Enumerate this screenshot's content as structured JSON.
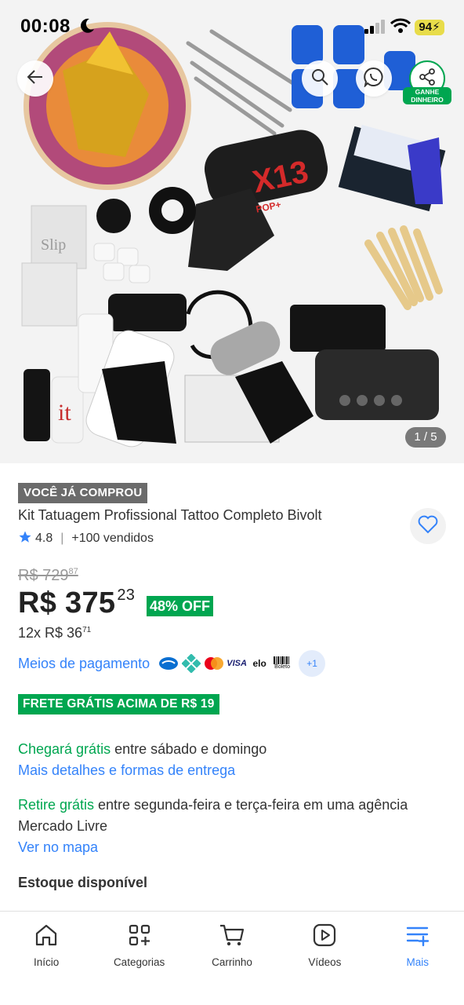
{
  "status_bar": {
    "time": "00:08",
    "battery": "94"
  },
  "gallery": {
    "page_counter": "1 / 5"
  },
  "header_actions": {
    "share_badge": "GANHE DINHEIRO"
  },
  "product": {
    "bought_badge": "VOCÊ JÁ COMPROU",
    "title": "Kit Tatuagem Profissional Tattoo Completo Bivolt",
    "rating": "4.8",
    "sold": "+100 vendidos",
    "old_price_main": "R$ 729",
    "old_price_cents": "87",
    "price_main": "R$ 375",
    "price_cents": "23",
    "discount": "48% OFF",
    "installments_main": "12x R$ 36",
    "installments_cents": "71"
  },
  "payment": {
    "link": "Meios de pagamento",
    "methods": [
      "mercado-pago-icon",
      "pix-icon",
      "mastercard-icon",
      "visa-icon",
      "elo-icon",
      "boleto-icon"
    ],
    "visa": "VISA",
    "elo": "elo",
    "boleto": "Boleto",
    "more": "+1"
  },
  "shipping": {
    "frete_badge": "FRETE GRÁTIS ACIMA DE R$ 19",
    "arrive_label": "Chegará grátis",
    "arrive_text": " entre sábado e domingo",
    "delivery_link": "Mais detalhes e formas de entrega",
    "pickup_label": "Retire grátis",
    "pickup_text": " entre segunda-feira e terça-feira em uma agência Mercado Livre",
    "map_link": "Ver no mapa"
  },
  "stock": {
    "label": "Estoque disponível"
  },
  "nav": {
    "items": [
      {
        "label": "Início",
        "icon": "home-icon"
      },
      {
        "label": "Categorias",
        "icon": "categories-icon"
      },
      {
        "label": "Carrinho",
        "icon": "cart-icon"
      },
      {
        "label": "Vídeos",
        "icon": "videos-icon"
      },
      {
        "label": "Mais",
        "icon": "more-icon"
      }
    ]
  },
  "colors": {
    "accent_blue": "#3483fa",
    "green": "#00a650",
    "grey_badge": "#6b6b6b"
  },
  "product_art": {
    "machine_label": "X13",
    "machine_sub": "POP+",
    "slip_label": "Slip",
    "ink_label": "it"
  }
}
